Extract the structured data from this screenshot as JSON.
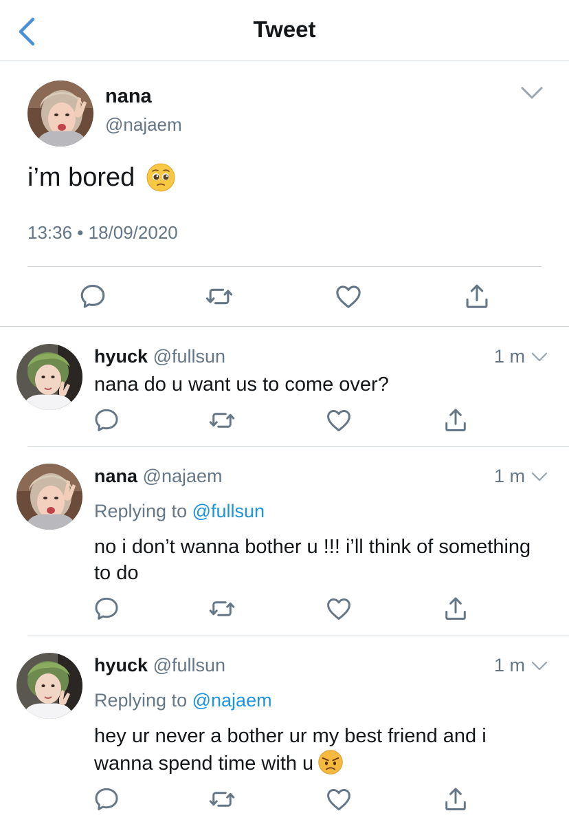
{
  "header": {
    "title": "Tweet"
  },
  "tweet": {
    "name": "nana",
    "handle": "@najaem",
    "text": "i’m bored",
    "emoji": "pleading-face-emoji",
    "timestamp": "13:36 • 18/09/2020"
  },
  "replies": [
    {
      "name": "hyuck",
      "handle": "@fullsun",
      "ago": "1 m",
      "replying_label": "",
      "replying_to": "",
      "text": "nana do u want us to come over?"
    },
    {
      "name": "nana",
      "handle": "@najaem",
      "ago": "1 m",
      "replying_label": "Replying to",
      "replying_to": "@fullsun",
      "text": "no i don’t wanna bother u !!! i’ll think of something to do"
    },
    {
      "name": "hyuck",
      "handle": "@fullsun",
      "ago": "1 m",
      "replying_label": "Replying to",
      "replying_to": "@najaem",
      "text": "hey ur never a bother ur my best friend and i wanna spend time with u",
      "emoji": "angry-face-emoji"
    }
  ],
  "colors": {
    "accent": "#1b95e0",
    "back_arrow": "#4a90d9",
    "secondary_text": "#657786",
    "icon": "#657786",
    "divider": "#cfd4d8"
  },
  "icons": {
    "reply": "reply-icon",
    "retweet": "retweet-icon",
    "like": "heart-icon",
    "share": "share-icon"
  }
}
